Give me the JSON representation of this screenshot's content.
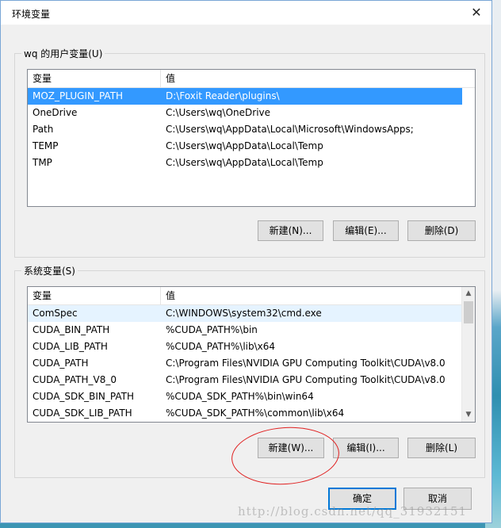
{
  "window": {
    "title": "环境变量",
    "close_glyph": "✕"
  },
  "user_vars": {
    "label": "wq 的用户变量(U)",
    "headers": {
      "name": "变量",
      "value": "值"
    },
    "rows": [
      {
        "name": "MOZ_PLUGIN_PATH",
        "value": "D:\\Foxit Reader\\plugins\\"
      },
      {
        "name": "OneDrive",
        "value": "C:\\Users\\wq\\OneDrive"
      },
      {
        "name": "Path",
        "value": "C:\\Users\\wq\\AppData\\Local\\Microsoft\\WindowsApps;"
      },
      {
        "name": "TEMP",
        "value": "C:\\Users\\wq\\AppData\\Local\\Temp"
      },
      {
        "name": "TMP",
        "value": "C:\\Users\\wq\\AppData\\Local\\Temp"
      }
    ],
    "selected_row": 0,
    "buttons": {
      "new": "新建(N)...",
      "edit": "编辑(E)...",
      "delete": "删除(D)"
    }
  },
  "system_vars": {
    "label": "系统变量(S)",
    "headers": {
      "name": "变量",
      "value": "值"
    },
    "rows": [
      {
        "name": "ComSpec",
        "value": "C:\\WINDOWS\\system32\\cmd.exe"
      },
      {
        "name": "CUDA_BIN_PATH",
        "value": " %CUDA_PATH%\\bin"
      },
      {
        "name": "CUDA_LIB_PATH",
        "value": "%CUDA_PATH%\\lib\\x64"
      },
      {
        "name": "CUDA_PATH",
        "value": "C:\\Program Files\\NVIDIA GPU Computing Toolkit\\CUDA\\v8.0"
      },
      {
        "name": "CUDA_PATH_V8_0",
        "value": "C:\\Program Files\\NVIDIA GPU Computing Toolkit\\CUDA\\v8.0"
      },
      {
        "name": "CUDA_SDK_BIN_PATH",
        "value": "%CUDA_SDK_PATH%\\bin\\win64"
      },
      {
        "name": "CUDA_SDK_LIB_PATH",
        "value": "%CUDA_SDK_PATH%\\common\\lib\\x64"
      }
    ],
    "buttons": {
      "new": "新建(W)...",
      "edit": "编辑(I)...",
      "delete": "删除(L)"
    }
  },
  "footer": {
    "ok": "确定",
    "cancel": "取消"
  },
  "watermark": "http://blog.csdn.net/qq_31932151",
  "colors": {
    "selection": "#3399ff",
    "annotation_circle": "#e02020",
    "default_button_border": "#0078d7"
  }
}
